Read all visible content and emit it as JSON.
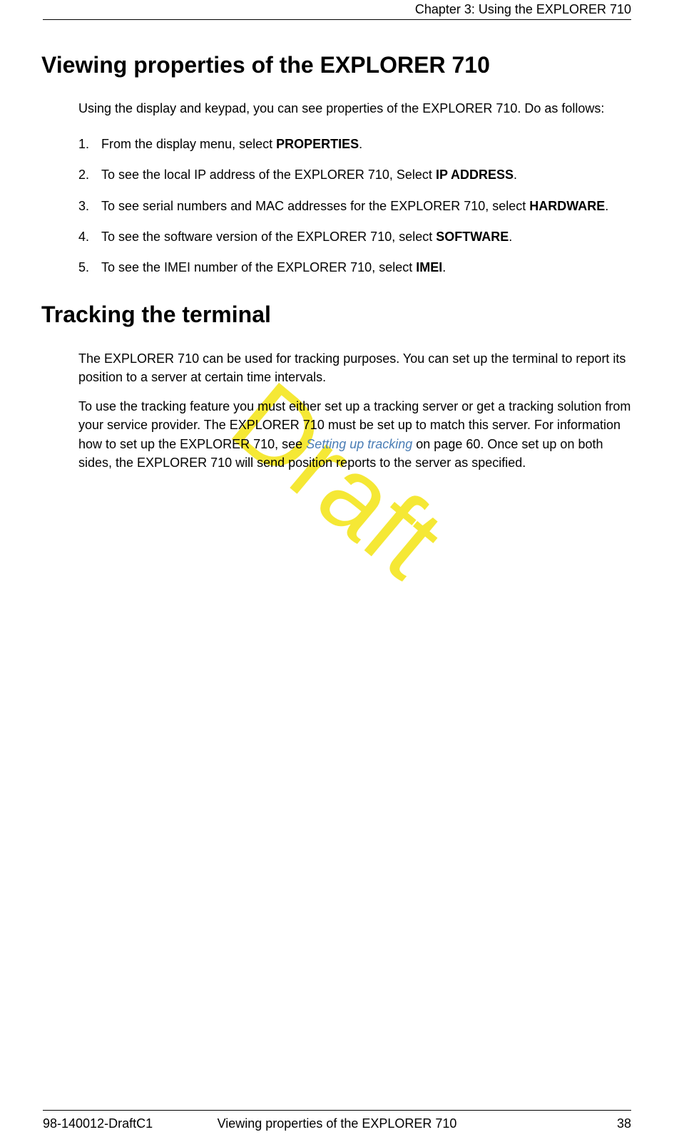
{
  "header": {
    "chapter": "Chapter 3: Using the EXPLORER 710"
  },
  "section1": {
    "title": "Viewing properties of the EXPLORER 710",
    "intro": "Using the display and keypad, you can see properties of the EXPLORER 710. Do as follows:",
    "steps": [
      {
        "text": "From the display menu, select ",
        "bold": "PROPERTIES",
        "after": "."
      },
      {
        "text": "To see the local IP address of the EXPLORER 710, Select ",
        "bold": "IP ADDRESS",
        "after": "."
      },
      {
        "text": "To see serial numbers and MAC addresses for the EXPLORER 710, select ",
        "bold": "HARDWARE",
        "after": "."
      },
      {
        "text": "To see the software version of the EXPLORER 710, select ",
        "bold": "SOFTWARE",
        "after": "."
      },
      {
        "text": "To see the IMEI number of the EXPLORER 710, select ",
        "bold": "IMEI",
        "after": "."
      }
    ]
  },
  "section2": {
    "title": "Tracking the terminal",
    "para1": "The EXPLORER 710 can be used for tracking purposes. You can set up the terminal to report its position to a server at certain time intervals.",
    "para2_before": "To use the tracking feature you must either set up a tracking server or get a tracking solution from your service provider. The EXPLORER 710 must be set up to match this server. For information how to set up the EXPLORER 710, see ",
    "para2_link": "Setting up tracking",
    "para2_after": " on page 60. Once set up on both sides, the EXPLORER 710 will send position reports to the server as specified."
  },
  "watermark": "Draft",
  "footer": {
    "left": "98-140012-DraftC1",
    "center": "Viewing properties of the EXPLORER 710",
    "right": "38"
  }
}
